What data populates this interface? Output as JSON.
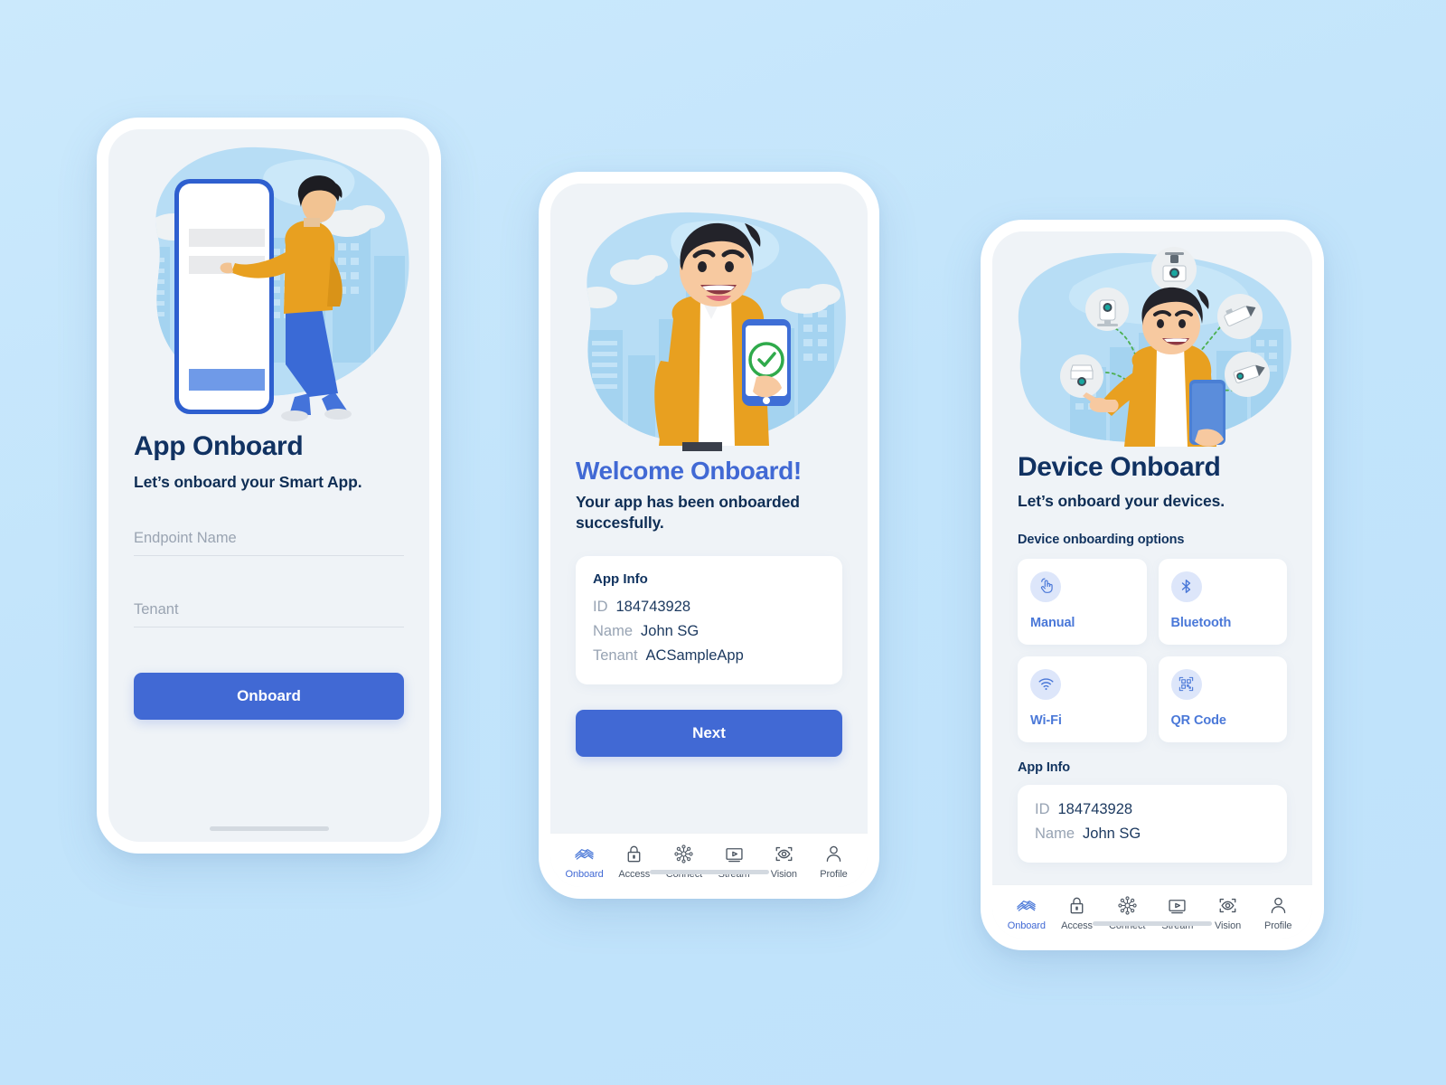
{
  "theme": {
    "background": "#c5e7fb",
    "accent_blue": "#4169d4",
    "navy": "#113262",
    "screen_bg": "#eff3f7",
    "placeholder_gray": "#9aa4b2",
    "icon_chip_bg": "#dde6fa",
    "illustration_orange": "#e8a020",
    "illustration_blob": "#b7ddf5",
    "check_green": "#2faa4b"
  },
  "phone1": {
    "illustration": {
      "name": "person-pointing-at-large-phone",
      "alt": "Man in orange jacket pointing at a large smartphone in front of a city skyline"
    },
    "title": "App Onboard",
    "subtitle": "Let’s onboard your Smart App.",
    "fields": [
      {
        "name": "endpoint-name",
        "placeholder": "Endpoint Name",
        "value": ""
      },
      {
        "name": "tenant",
        "placeholder": "Tenant",
        "value": ""
      }
    ],
    "submit_label": "Onboard"
  },
  "phone2": {
    "illustration": {
      "name": "person-holding-phone-with-checkmark",
      "alt": "Smiling man in orange jacket holding a phone showing a green success checkmark"
    },
    "title": "Welcome Onboard!",
    "subtitle": "Your app has been onboarded succesfully.",
    "app_info": {
      "card_title": "App Info",
      "rows": [
        {
          "key": "ID",
          "value": "184743928"
        },
        {
          "key": "Name",
          "value": "John SG"
        },
        {
          "key": "Tenant",
          "value": "ACSampleApp"
        }
      ]
    },
    "next_label": "Next"
  },
  "phone3": {
    "illustration": {
      "name": "person-connecting-camera-devices",
      "alt": "Man holding a phone surrounded by five security camera icons linked by green dotted lines"
    },
    "title": "Device Onboard",
    "subtitle": "Let’s onboard your devices.",
    "options_label": "Device onboarding options",
    "options": [
      {
        "icon": "tap-hand-icon",
        "label": "Manual"
      },
      {
        "icon": "bluetooth-icon",
        "label": "Bluetooth"
      },
      {
        "icon": "wifi-icon",
        "label": "Wi-Fi"
      },
      {
        "icon": "qr-code-icon",
        "label": "QR Code"
      }
    ],
    "app_info": {
      "section_title": "App Info",
      "rows": [
        {
          "key": "ID",
          "value": "184743928"
        },
        {
          "key": "Name",
          "value": "John SG"
        }
      ]
    }
  },
  "tabbar": {
    "items": [
      {
        "icon": "handshake-icon",
        "label": "Onboard",
        "active": true
      },
      {
        "icon": "lock-icon",
        "label": "Access",
        "active": false
      },
      {
        "icon": "network-hub-icon",
        "label": "Connect",
        "active": false
      },
      {
        "icon": "monitor-play-icon",
        "label": "Stream",
        "active": false
      },
      {
        "icon": "eye-scan-icon",
        "label": "Vision",
        "active": false
      },
      {
        "icon": "person-icon",
        "label": "Profile",
        "active": false
      }
    ]
  }
}
